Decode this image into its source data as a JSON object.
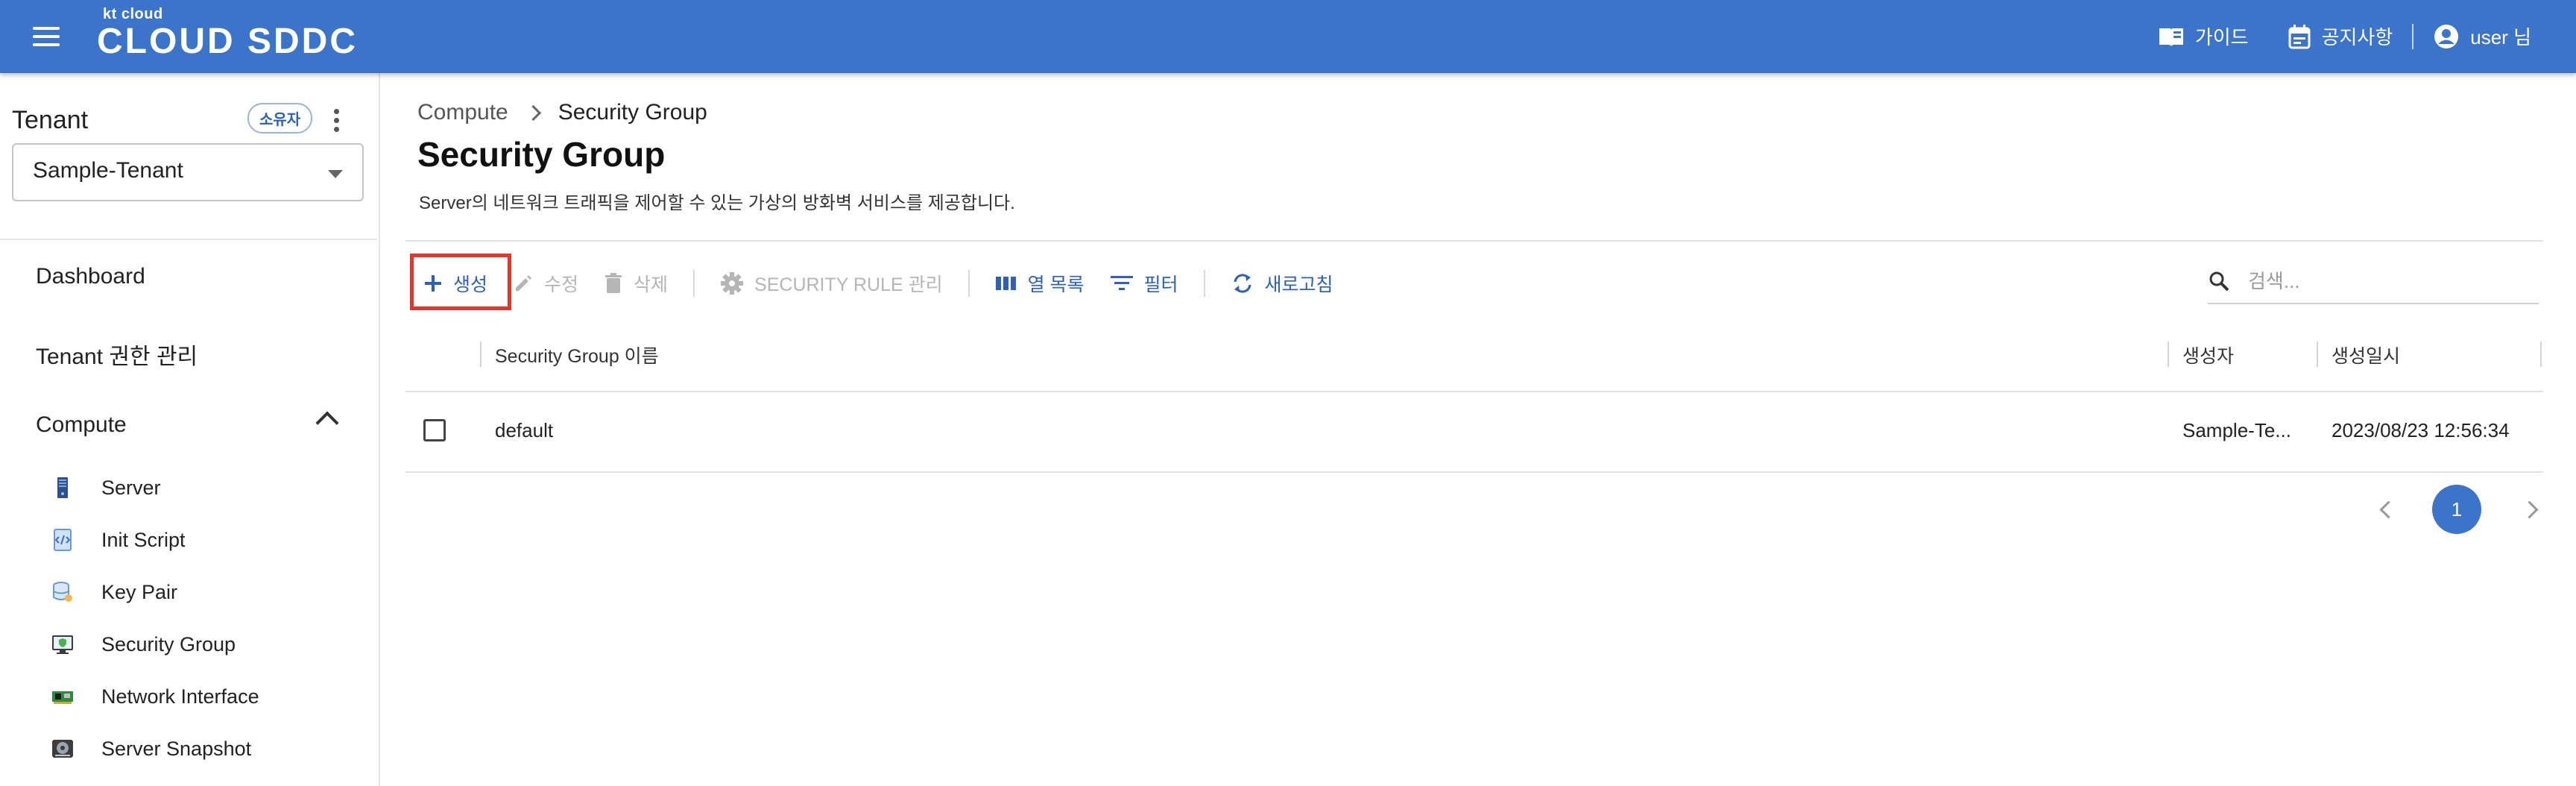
{
  "header": {
    "logo_small": "kt cloud",
    "logo_big": "CLOUD SDDC",
    "guide": "가이드",
    "notice": "공지사항",
    "user": "user 님",
    "bar_color": "#3b74c8"
  },
  "sidebar": {
    "tenant_label": "Tenant",
    "owner_badge": "소유자",
    "tenant_value": "Sample-Tenant",
    "dashboard": "Dashboard",
    "tenant_auth": "Tenant 권한 관리",
    "compute": "Compute",
    "sub_items": [
      {
        "label": "Server",
        "icon": "server-icon"
      },
      {
        "label": "Init Script",
        "icon": "script-icon"
      },
      {
        "label": "Key Pair",
        "icon": "key-pair-icon"
      },
      {
        "label": "Security Group",
        "icon": "security-group-icon"
      },
      {
        "label": "Network Interface",
        "icon": "network-interface-icon"
      },
      {
        "label": "Server Snapshot",
        "icon": "snapshot-icon"
      }
    ]
  },
  "breadcrumb": {
    "parent": "Compute",
    "current": "Security Group"
  },
  "page": {
    "title": "Security Group",
    "description": "Server의 네트워크 트래픽을 제어할 수 있는 가상의 방화벽 서비스를 제공합니다."
  },
  "toolbar": {
    "create": "생성",
    "edit": "수정",
    "delete": "삭제",
    "rule_manage": "SECURITY RULE 관리",
    "columns": "열 목록",
    "filter": "필터",
    "refresh": "새로고침"
  },
  "search": {
    "placeholder": "검색..."
  },
  "table": {
    "headers": [
      "Security Group 이름",
      "생성자",
      "생성일시"
    ],
    "rows": [
      {
        "name": "default",
        "creator": "Sample-Te...",
        "created": "2023/08/23 12:56:34"
      }
    ]
  },
  "pagination": {
    "current": "1"
  }
}
